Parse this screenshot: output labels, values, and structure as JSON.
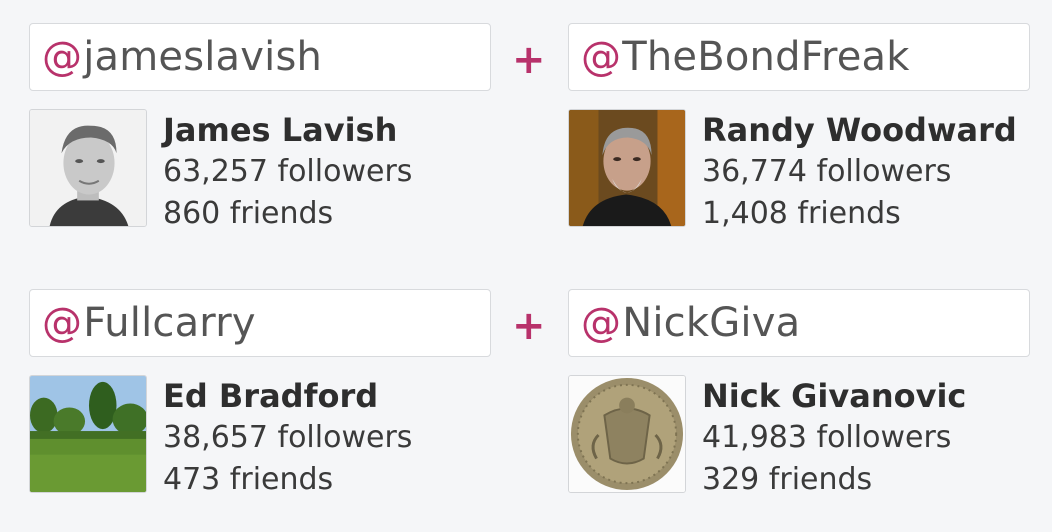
{
  "pairs": [
    {
      "left": {
        "at": "@",
        "handle": "jameslavish",
        "name": "James Lavish",
        "followers": "63,257 followers",
        "friends": "860 friends"
      },
      "plus": "+",
      "right": {
        "at": "@",
        "handle": "TheBondFreak",
        "name": "Randy Woodward",
        "followers": "36,774 followers",
        "friends": "1,408 friends"
      }
    },
    {
      "left": {
        "at": "@",
        "handle": "Fullcarry",
        "name": "Ed Bradford",
        "followers": "38,657 followers",
        "friends": "473 friends"
      },
      "plus": "+",
      "right": {
        "at": "@",
        "handle": "NickGiva",
        "name": "Nick Givanovic",
        "followers": "41,983 followers",
        "friends": "329 friends"
      }
    }
  ],
  "colors": {
    "accent": "#b8326b",
    "background": "#f5f6f8",
    "text": "#333333"
  }
}
